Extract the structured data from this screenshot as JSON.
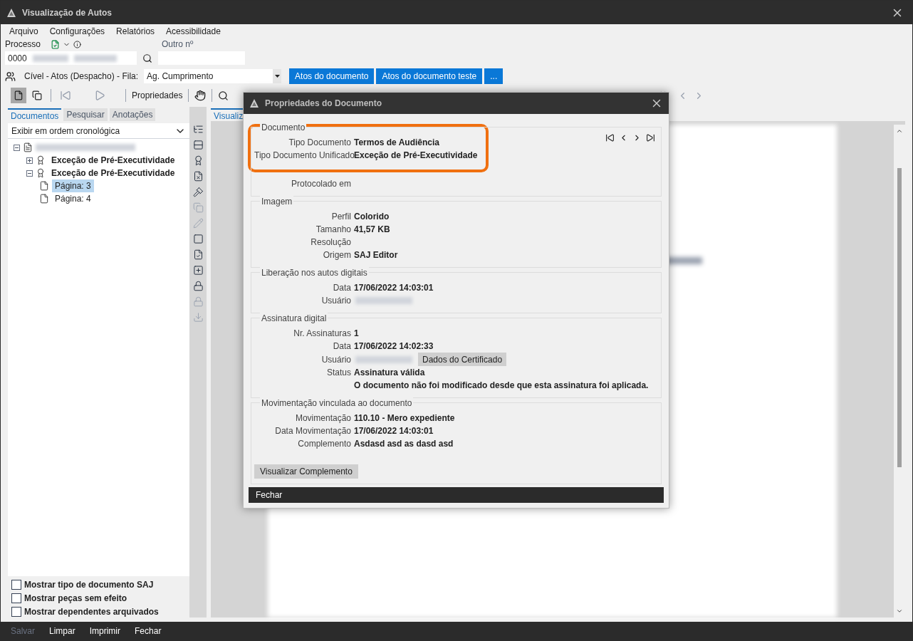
{
  "window": {
    "title": "Visualização de Autos"
  },
  "menu": [
    {
      "label": "Arquivo"
    },
    {
      "label": "Configurações"
    },
    {
      "label": "Relatórios"
    },
    {
      "label": "Acessibilidade"
    }
  ],
  "process_bar": {
    "processo_label": "Processo",
    "processo_value": "0000",
    "outro_label": "Outro nº"
  },
  "queue_bar": {
    "label": "Cível - Atos (Despacho) - Fila:",
    "queue": "Ag. Cumprimento",
    "buttons": [
      "Atos do documento",
      "Atos do documento teste",
      "..."
    ]
  },
  "toolbar": {
    "properties": "Propriedades"
  },
  "left_panel": {
    "tabs": [
      {
        "label": "Documentos",
        "selected": true
      },
      {
        "label": "Pesquisar",
        "selected": false
      },
      {
        "label": "Anotações",
        "selected": false
      }
    ],
    "order_select": "Exibir em ordem cronológica",
    "tree": [
      {
        "kind": "process",
        "expanded": true,
        "children": [
          {
            "kind": "document",
            "label": "Exceção de Pré-Executividade",
            "expanded": false
          },
          {
            "kind": "document",
            "label": "Exceção de Pré-Executividade",
            "expanded": true,
            "children": [
              {
                "kind": "page",
                "label": "Página: 3",
                "selected": true
              },
              {
                "kind": "page",
                "label": "Página: 4",
                "selected": false
              }
            ]
          }
        ]
      }
    ],
    "options": [
      {
        "label": "Mostrar tipo de documento SAJ",
        "checked": false
      },
      {
        "label": "Mostrar peças sem efeito",
        "checked": false
      },
      {
        "label": "Mostrar dependentes arquivados",
        "checked": false
      }
    ]
  },
  "viewer": {
    "tab": "Visualiz"
  },
  "dialog": {
    "title": "Propriedades do Documento",
    "groups": [
      {
        "title": "Documento",
        "fields": [
          {
            "label": "Tipo Documento",
            "value": "Termos de Audiência"
          },
          {
            "label": "Tipo Documento Unificado",
            "value": "Exceção de Pré-Executividade"
          },
          {
            "label": "Protocolado em"
          }
        ]
      },
      {
        "title": "Imagem",
        "fields": [
          {
            "label": "Perfil",
            "value": "Colorido"
          },
          {
            "label": "Tamanho",
            "value": "41,57 KB"
          },
          {
            "label": "Resolução"
          },
          {
            "label": "Origem",
            "value": "SAJ Editor"
          }
        ]
      },
      {
        "title": "Liberação nos autos digitais",
        "fields": [
          {
            "label": "Data",
            "value": "17/06/2022 14:03:01"
          },
          {
            "label": "Usuário",
            "redacted": true
          }
        ]
      },
      {
        "title": "Assinatura digital",
        "fields": [
          {
            "label": "Nr. Assinaturas",
            "value": "1"
          },
          {
            "label": "Data",
            "value": "17/06/2022 14:02:33"
          },
          {
            "label": "Usuário",
            "redacted": true,
            "button": "Dados do Certificado"
          },
          {
            "label": "Status",
            "value": "Assinatura válida"
          },
          {
            "value": "O documento não foi modificado desde que esta assinatura foi aplicada."
          }
        ]
      },
      {
        "title": "Movimentação vinculada ao documento",
        "fields": [
          {
            "label": "Movimentação",
            "value": "110.10 - Mero expediente"
          },
          {
            "label": "Data Movimentação",
            "value": "17/06/2022 14:03:01"
          },
          {
            "label": "Complemento",
            "value": "Asdasd asd as dasd asd"
          }
        ],
        "button": "Visualizar Complemento"
      }
    ],
    "close": "Fechar"
  },
  "footer": [
    {
      "label": "Salvar",
      "disabled": true
    },
    {
      "label": "Limpar",
      "disabled": false
    },
    {
      "label": "Imprimir",
      "disabled": false
    },
    {
      "label": "Fechar",
      "disabled": false
    }
  ]
}
